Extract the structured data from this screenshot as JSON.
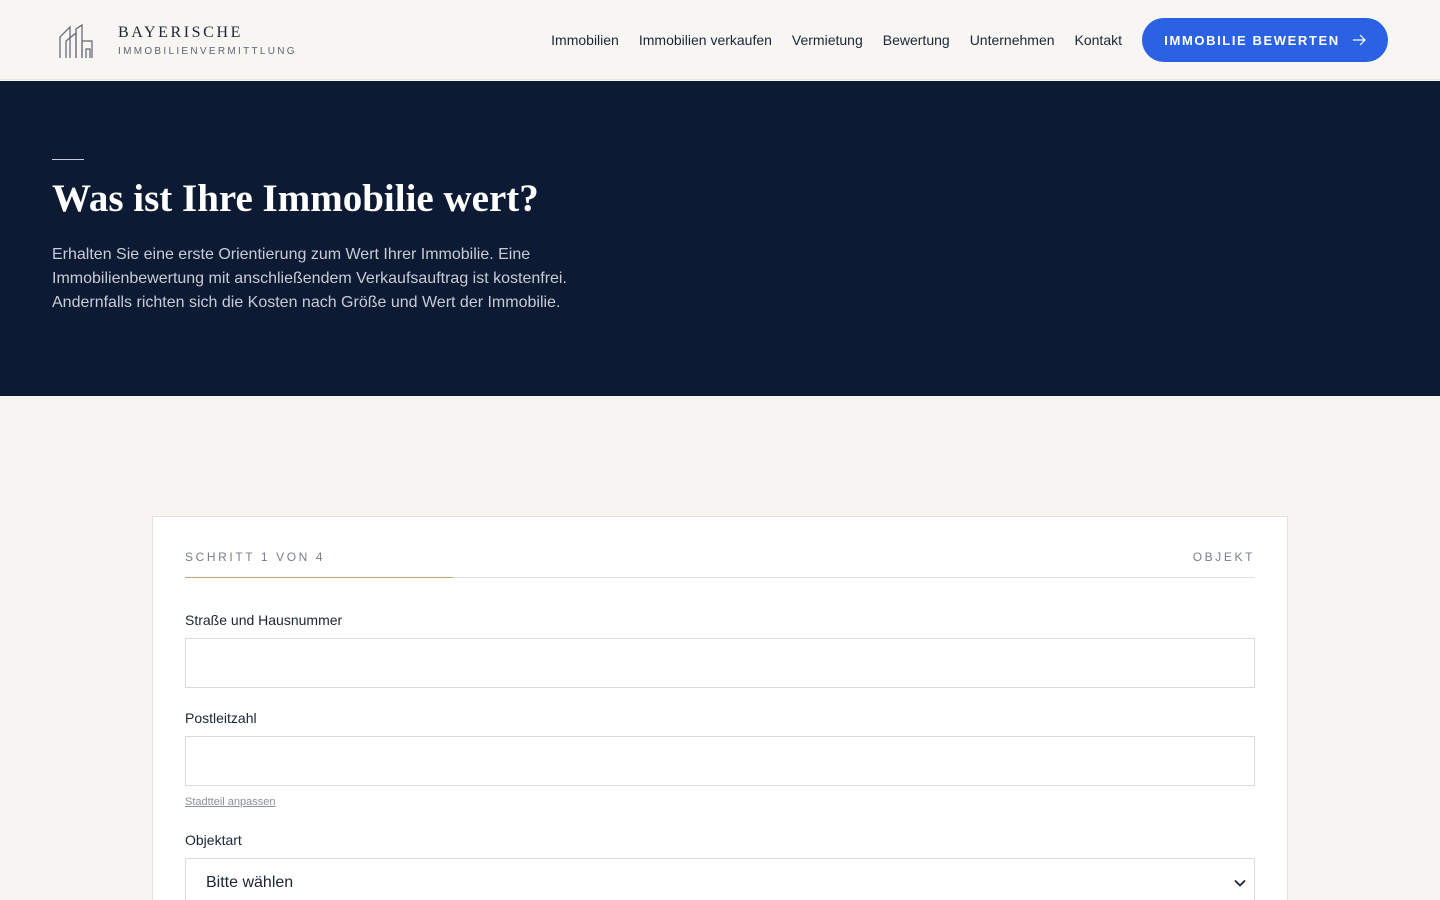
{
  "brand": {
    "name": "BAYERISCHE",
    "tagline": "IMMOBILIENVERMITTLUNG"
  },
  "nav": {
    "items": [
      {
        "label": "Immobilien"
      },
      {
        "label": "Immobilien verkaufen"
      },
      {
        "label": "Vermietung"
      },
      {
        "label": "Bewertung"
      },
      {
        "label": "Unternehmen"
      },
      {
        "label": "Kontakt"
      }
    ],
    "cta_label": "IMMOBILIE BEWERTEN"
  },
  "hero": {
    "title": "Was ist Ihre Immobilie wert?",
    "description": "Erhalten Sie eine erste Orientierung zum Wert Ihrer Immobilie. Eine Immobilienbewertung mit anschließendem Verkaufsauftrag ist kostenfrei. Andernfalls richten sich die Kosten nach Größe und Wert der Immobilie."
  },
  "form": {
    "step_label": "SCHRITT 1 VON 4",
    "step_name": "OBJEKT",
    "progress_fraction": 0.25,
    "street_label": "Straße und Hausnummer",
    "street_value": "",
    "zip_label": "Postleitzahl",
    "zip_value": "",
    "district_link": "Stadtteil anpassen",
    "type_label": "Objektart",
    "type_value": "Bitte wählen"
  },
  "colors": {
    "accent": "#2b62e3",
    "hero_bg": "#0c1b33",
    "progress": "#c9a27a",
    "page_bg": "#f6f5f2"
  }
}
